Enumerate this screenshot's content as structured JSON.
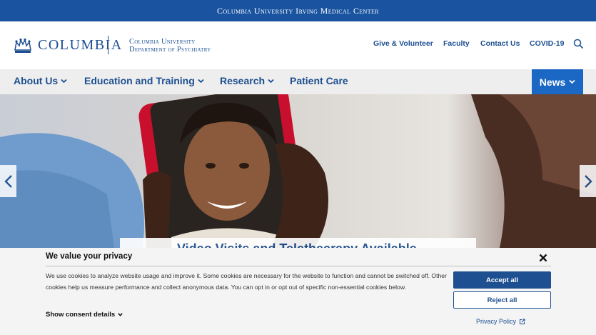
{
  "topbar": {
    "title": "Columbia University Irving Medical Center"
  },
  "header": {
    "logo_word": "COLUMBIA",
    "dept_line1": "Columbia University",
    "dept_line2": "Department of Psychiatry",
    "utility_links": [
      "Give & Volunteer",
      "Faculty",
      "Contact Us",
      "COVID-19"
    ]
  },
  "nav": {
    "items": [
      "About Us",
      "Education and Training",
      "Research",
      "Patient Care"
    ],
    "news": "News"
  },
  "hero": {
    "caption": "Video Visits and Telethearapy Available"
  },
  "consent": {
    "title": "We value your privacy",
    "body": "We use cookies to analyze website usage and improve it. Some cookies are necessary for the website to function and cannot be switched off. Other cookies help us measure performance and collect anonymous data. You can opt in or opt out of specific non-essential cookies below.",
    "details": "Show consent details",
    "accept": "Accept all",
    "reject": "Reject all",
    "privacy": "Privacy Policy"
  },
  "colors": {
    "brand_blue": "#1d4f91",
    "topbar_blue": "#1a54a0",
    "news_blue": "#1a67c4"
  },
  "icons": [
    "crown-icon",
    "search-icon",
    "chevron-down-icon",
    "chevron-left-icon",
    "chevron-right-icon",
    "close-icon",
    "external-link-icon"
  ]
}
